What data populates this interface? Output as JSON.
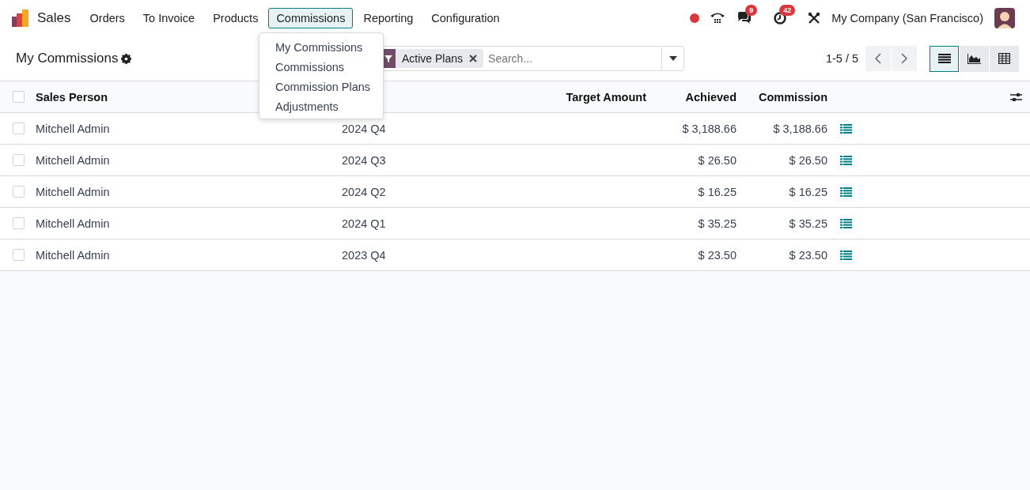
{
  "navbar": {
    "app_name": "Sales",
    "menu": [
      {
        "label": "Orders",
        "selected": false
      },
      {
        "label": "To Invoice",
        "selected": false
      },
      {
        "label": "Products",
        "selected": false
      },
      {
        "label": "Commissions",
        "selected": true
      },
      {
        "label": "Reporting",
        "selected": false
      },
      {
        "label": "Configuration",
        "selected": false
      }
    ],
    "dropdown": [
      "My Commissions",
      "Commissions",
      "Commission Plans",
      "Adjustments"
    ],
    "messages_badge": "9",
    "activities_badge": "42",
    "company": "My Company (San Francisco)"
  },
  "control_panel": {
    "title": "My Commissions",
    "facet": "Active Plans",
    "search": {
      "placeholder": "Search..."
    },
    "pager": "1-5 / 5",
    "views": [
      {
        "kind": "list",
        "selected": true
      },
      {
        "kind": "graph",
        "selected": false
      },
      {
        "kind": "pivot",
        "selected": false
      }
    ]
  },
  "table": {
    "select_all": {
      "selected": false
    },
    "headers": {
      "sales_person": "Sales Person",
      "target_amount": "Target Amount",
      "achieved": "Achieved",
      "commission": "Commission"
    },
    "rows": [
      {
        "sales_person": "Mitchell Admin",
        "period": "2024 Q4",
        "achieved": "$ 3,188.66",
        "commission": "$ 3,188.66",
        "selected": false
      },
      {
        "sales_person": "Mitchell Admin",
        "period": "2024 Q3",
        "achieved": "$ 26.50",
        "commission": "$ 26.50",
        "selected": false
      },
      {
        "sales_person": "Mitchell Admin",
        "period": "2024 Q2",
        "achieved": "$ 16.25",
        "commission": "$ 16.25",
        "selected": false
      },
      {
        "sales_person": "Mitchell Admin",
        "period": "2024 Q1",
        "achieved": "$ 35.25",
        "commission": "$ 35.25",
        "selected": false
      },
      {
        "sales_person": "Mitchell Admin",
        "period": "2023 Q4",
        "achieved": "$ 23.50",
        "commission": "$ 23.50",
        "selected": false
      }
    ]
  }
}
